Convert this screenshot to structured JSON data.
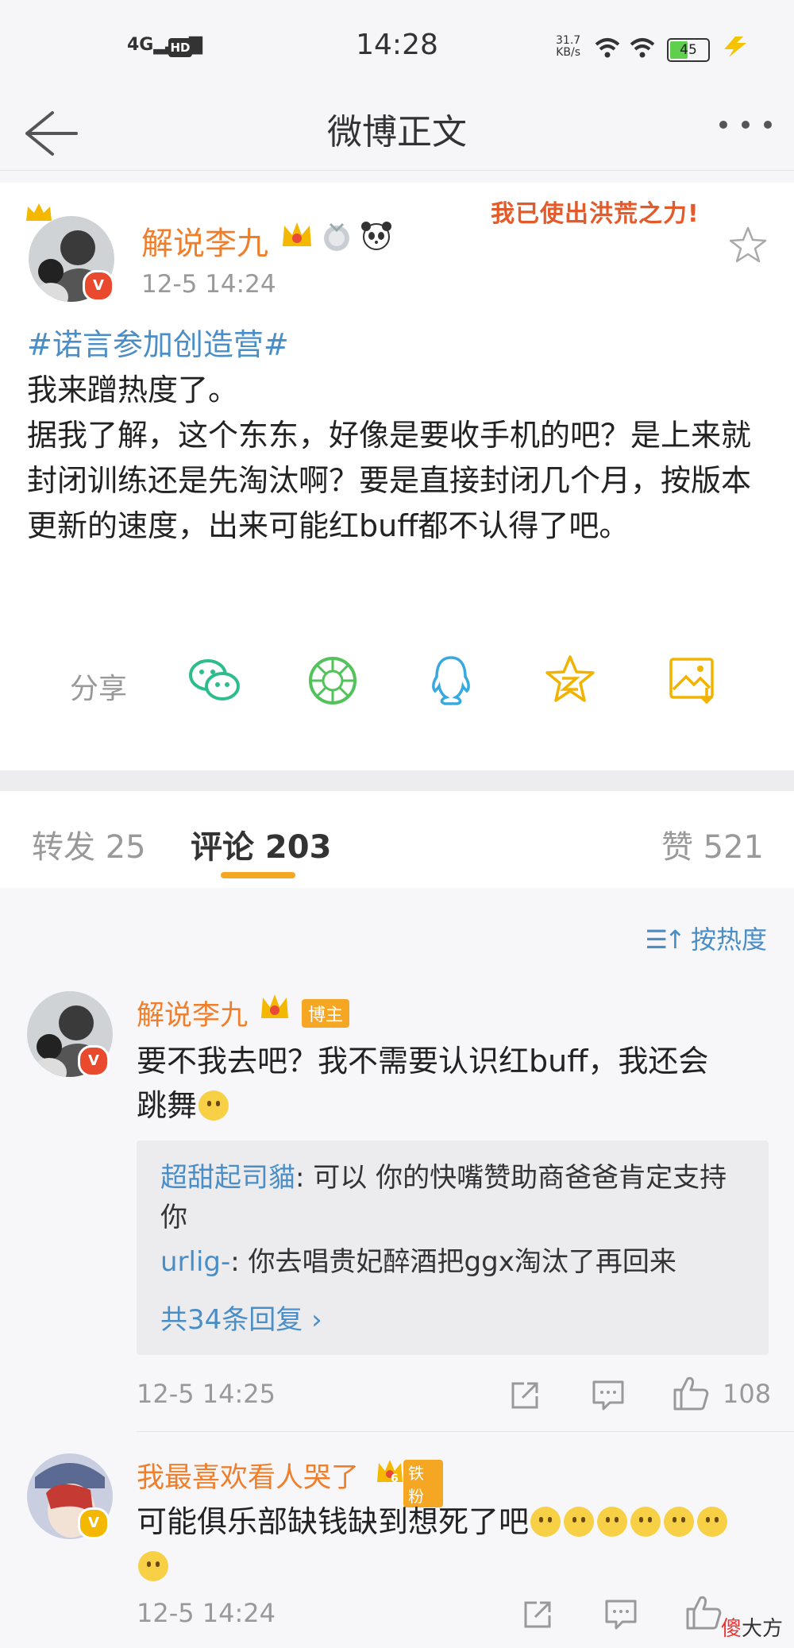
{
  "status_bar": {
    "network": "4G",
    "hd": "HD",
    "time": "14:28",
    "speed_value": "31.7",
    "speed_unit": "KB/s",
    "battery": "45"
  },
  "nav": {
    "title": "微博正文",
    "back_icon": "back-arrow-icon",
    "more_icon": "more-icon"
  },
  "post": {
    "author": "解说李九",
    "time": "12-5 14:24",
    "sticker": "我已使出洪荒之力!",
    "hashtag": "#诺言参加创造营#",
    "body": "我来蹭热度了。\n据我了解，这个东东，好像是要收手机的吧？是上来就封闭训练还是先淘汰啊？要是直接封闭几个月，按版本更新的速度，出来可能红buff都不认得了吧。",
    "share_label": "分享",
    "share_icons": [
      "wechat-icon",
      "moments-icon",
      "qq-icon",
      "qzone-icon",
      "save-image-icon"
    ]
  },
  "tabs": {
    "repost": "转发 25",
    "comments": "评论 203",
    "likes": "赞 521"
  },
  "comments": {
    "sort_label": "按热度",
    "items": [
      {
        "name": "解说李九",
        "badge": "博主",
        "text_line1": "要不我去吧？我不需要认识红buff，我还会",
        "text_line2": "跳舞",
        "replies": [
          {
            "name": "超甜起司貓",
            "text": ": 可以 你的快嘴赞助商爸爸肯定支持你"
          },
          {
            "name": "urlig-",
            "text": ": 你去唱贵妃醉酒把ggx淘汰了再回来"
          }
        ],
        "more_replies": "共34条回复 ›",
        "time": "12-5 14:25",
        "likes": "108"
      },
      {
        "name": "我最喜欢看人哭了",
        "fan_badge": "铁粉",
        "fan_level": "6",
        "text": "可能俱乐部缺钱缺到想死了吧",
        "time": "12-5 14:24"
      }
    ]
  },
  "watermark": {
    "brand_red": "傻",
    "brand_rest": "大方"
  },
  "colors": {
    "accent_orange": "#f07f2c",
    "link_blue": "#4a8ec7",
    "tab_underline": "#f5a623"
  }
}
